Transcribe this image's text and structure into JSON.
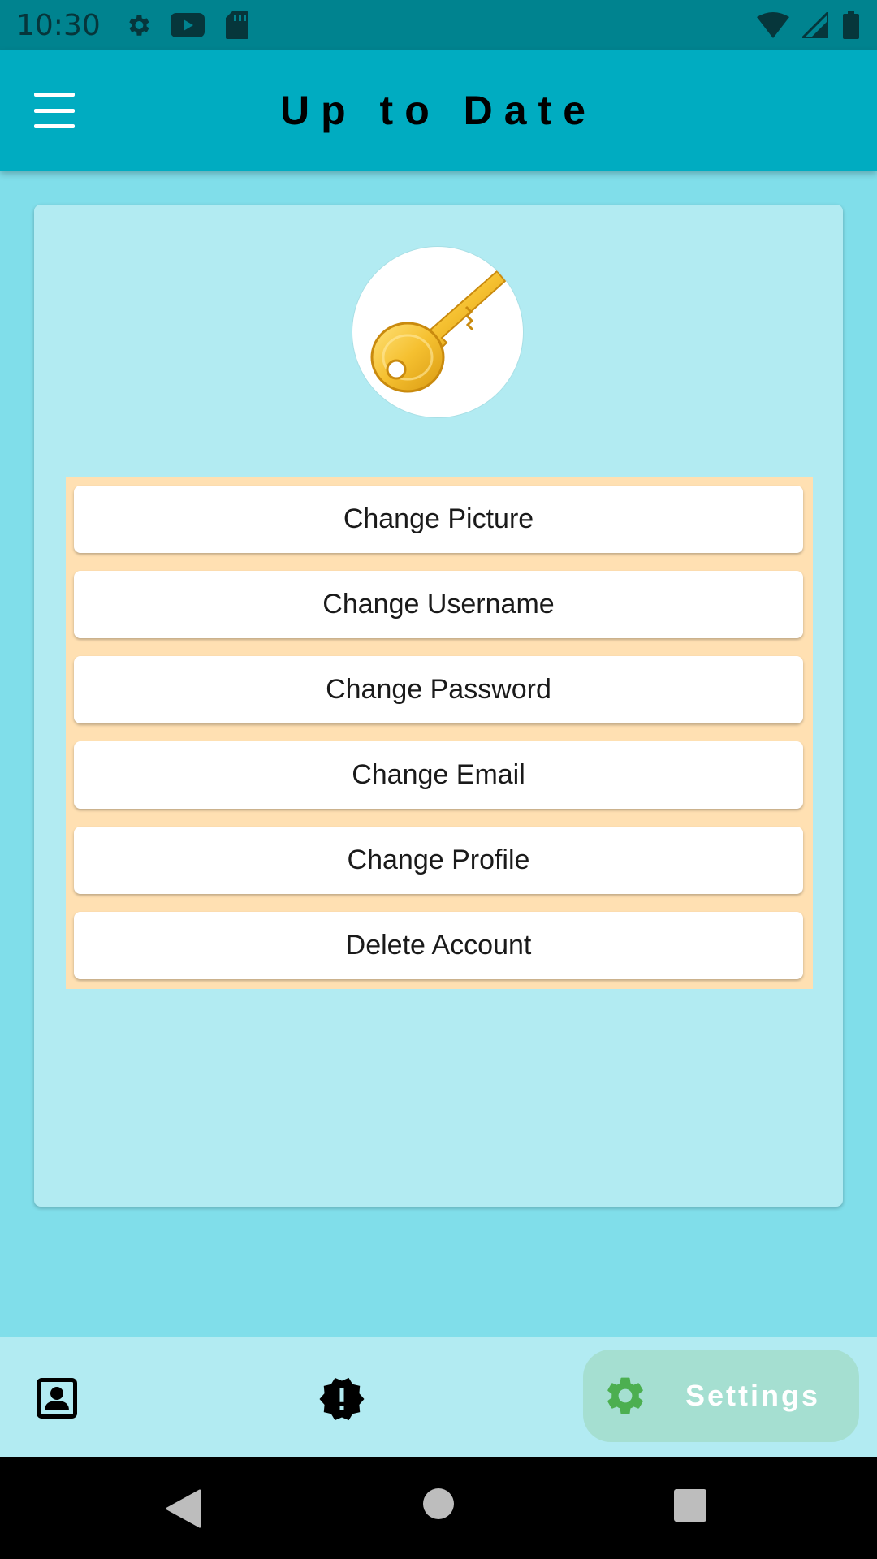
{
  "status_bar": {
    "time": "10:30",
    "left_icons": [
      "settings-icon",
      "youtube-icon",
      "sd-card-icon"
    ],
    "right_icons": [
      "wifi-icon",
      "cell-signal-icon",
      "battery-icon"
    ]
  },
  "app_bar": {
    "title": "Up to Date",
    "menu_icon": "hamburger-menu-icon"
  },
  "profile": {
    "avatar_icon": "key-icon"
  },
  "actions": [
    {
      "label": "Change Picture"
    },
    {
      "label": "Change Username"
    },
    {
      "label": "Change Password"
    },
    {
      "label": "Change Email"
    },
    {
      "label": "Change Profile"
    },
    {
      "label": "Delete Account"
    }
  ],
  "bottom_nav": {
    "items": [
      {
        "icon": "contact-portrait-icon",
        "label": ""
      },
      {
        "icon": "alert-badge-icon",
        "label": ""
      },
      {
        "icon": "settings-gear-icon",
        "label": "Settings",
        "selected": true
      }
    ]
  },
  "system_nav": {
    "buttons": [
      "back-icon",
      "home-icon",
      "recents-icon"
    ]
  },
  "colors": {
    "status_bar": "#00838f",
    "app_bar": "#00acc1",
    "background": "#80deea",
    "card": "#b2ebf2",
    "button_panel": "#ffe0b2",
    "nav_selected_pill": "#a5dfd1",
    "settings_gear": "#4caf50"
  }
}
